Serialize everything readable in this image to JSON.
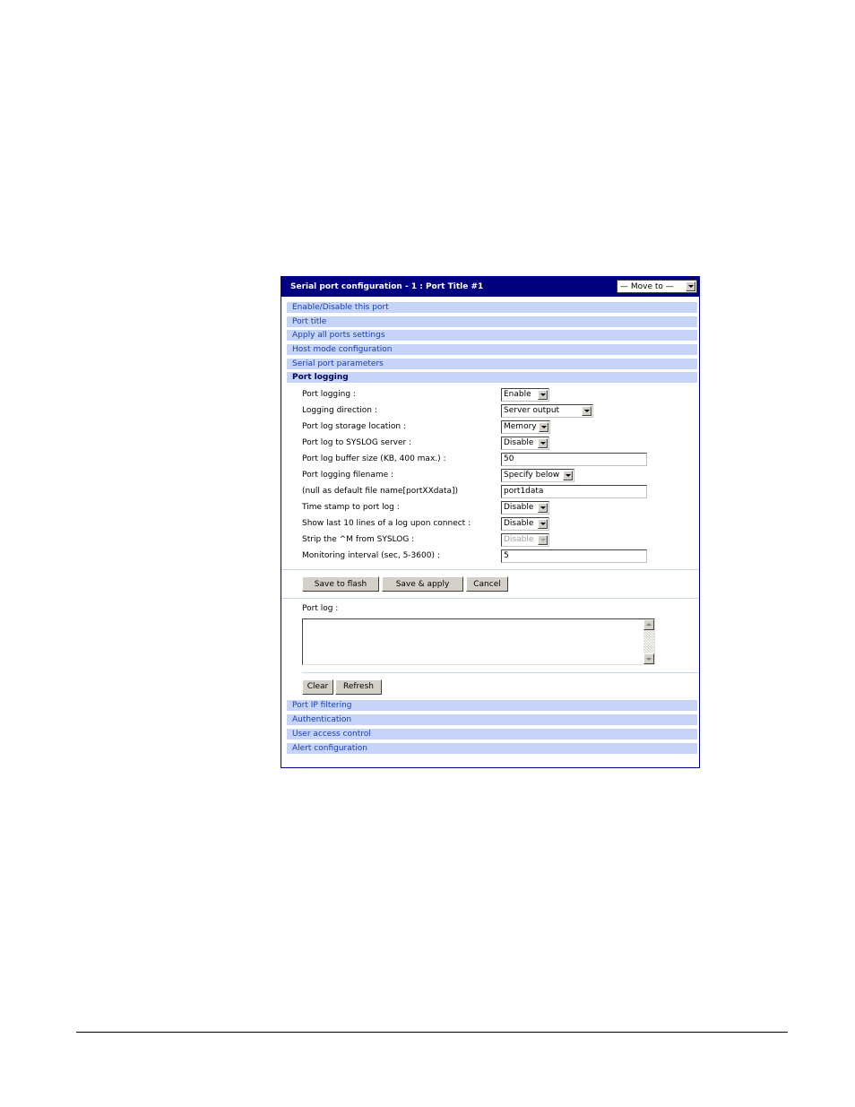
{
  "header": {
    "title": "Serial port configuration - 1 : Port Title #1",
    "move_to": "— Move to —"
  },
  "sections_top": [
    {
      "label": "Enable/Disable this port"
    },
    {
      "label": "Port title"
    },
    {
      "label": "Apply all ports settings"
    },
    {
      "label": "Host mode configuration"
    },
    {
      "label": "Serial port parameters"
    },
    {
      "label": "Port logging",
      "active": true
    }
  ],
  "form": {
    "fields": [
      {
        "label": "Port logging :",
        "type": "select",
        "value": "Enable"
      },
      {
        "label": "Logging direction :",
        "type": "select",
        "value": "Server output"
      },
      {
        "label": "Port log storage location :",
        "type": "select",
        "value": "Memory"
      },
      {
        "label": "Port log to SYSLOG server :",
        "type": "select",
        "value": "Disable"
      },
      {
        "label": "Port log buffer size (KB, 400 max.) :",
        "type": "text",
        "value": "50"
      },
      {
        "label": "Port logging filename :",
        "type": "select",
        "value": "Specify below"
      },
      {
        "label": "(null as default file name[portXXdata])",
        "type": "text",
        "value": "port1data"
      },
      {
        "label": "Time stamp to port log :",
        "type": "select",
        "value": "Disable"
      },
      {
        "label": "Show last 10 lines of a log upon connect :",
        "type": "select",
        "value": "Disable"
      },
      {
        "label": "Strip the ^M from SYSLOG :",
        "type": "select",
        "value": "Disable",
        "disabled": true
      },
      {
        "label": "Monitoring interval (sec, 5-3600) :",
        "type": "text",
        "value": "5"
      }
    ],
    "buttons": {
      "save_to_flash": "Save to flash",
      "save_apply": "Save & apply",
      "cancel": "Cancel"
    }
  },
  "port_log": {
    "label": "Port log :",
    "value": "",
    "buttons": {
      "clear": "Clear",
      "refresh": "Refresh"
    }
  },
  "sections_bottom": [
    {
      "label": "Port IP filtering"
    },
    {
      "label": "Authentication"
    },
    {
      "label": "User access control"
    },
    {
      "label": "Alert configuration"
    }
  ]
}
